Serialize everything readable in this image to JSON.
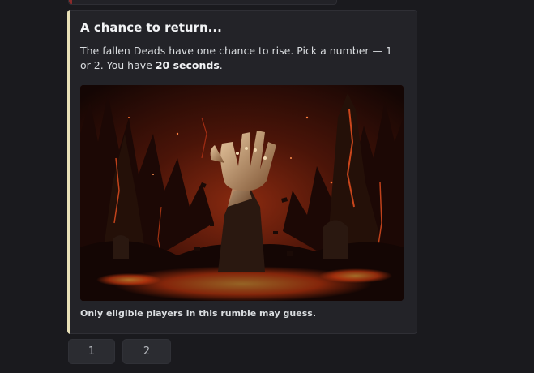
{
  "embed": {
    "title": "A chance to return...",
    "description_part1": "The fallen Deads have one chance to rise. Pick a number — 1 or 2. You have ",
    "description_bold": "20 seconds",
    "description_part2": ".",
    "footer": "Only eligible players in this rumble may guess.",
    "accent_color": "#e8e0b8"
  },
  "buttons": [
    {
      "label": "1"
    },
    {
      "label": "2"
    }
  ]
}
